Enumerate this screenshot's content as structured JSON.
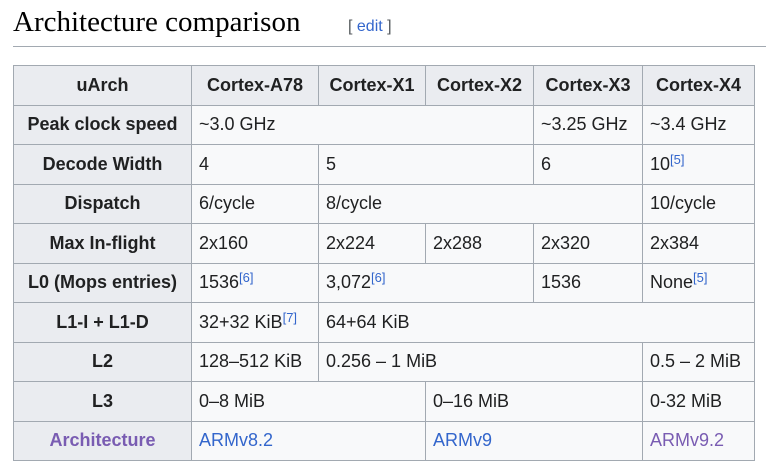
{
  "heading": {
    "title": "Architecture comparison",
    "edit_label": "edit",
    "open_bracket": "[",
    "close_bracket": "]"
  },
  "table": {
    "columns": [
      "uArch",
      "Cortex-A78",
      "Cortex-X1",
      "Cortex-X2",
      "Cortex-X3",
      "Cortex-X4"
    ],
    "rows": {
      "peak_clock": {
        "label": "Peak clock speed",
        "a78_x2": "~3.0 GHz",
        "x3": "~3.25 GHz",
        "x4": "~3.4 GHz"
      },
      "decode_width": {
        "label": "Decode Width",
        "a78": "4",
        "x1_x2": "5",
        "x3": "6",
        "x4": "10",
        "x4_ref": "[5]"
      },
      "dispatch": {
        "label": "Dispatch",
        "a78": "6/cycle",
        "x1_x3": "8/cycle",
        "x4": "10/cycle"
      },
      "max_inflight": {
        "label": "Max In-flight",
        "a78": "2x160",
        "x1": "2x224",
        "x2": "2x288",
        "x3": "2x320",
        "x4": "2x384"
      },
      "l0": {
        "label": "L0 (Mops entries)",
        "a78": "1536",
        "a78_ref": "[6]",
        "x1_x2": "3,072",
        "x1_x2_ref": "[6]",
        "x3": "1536",
        "x4": "None",
        "x4_ref": "[5]"
      },
      "l1": {
        "label": "L1-I + L1-D",
        "a78": "32+32 KiB",
        "a78_ref": "[7]",
        "x1_x4": "64+64 KiB"
      },
      "l2": {
        "label": "L2",
        "a78": "128–512 KiB",
        "x1_x3": "0.256 – 1 MiB",
        "x4": "0.5 – 2 MiB"
      },
      "l3": {
        "label": "L3",
        "a78_x1": "0–8 MiB",
        "x2_x3": "0–16 MiB",
        "x4": "0-32 MiB"
      },
      "architecture": {
        "label": "Architecture",
        "a78_x1": "ARMv8.2",
        "x2_x3": "ARMv9",
        "x4": "ARMv9.2"
      }
    }
  },
  "colors": {
    "link": "#3366cc",
    "visited_link": "#795cb2",
    "header_bg": "#eaecf0",
    "cell_bg": "#f8f9fa",
    "border": "#a2a9b1"
  }
}
